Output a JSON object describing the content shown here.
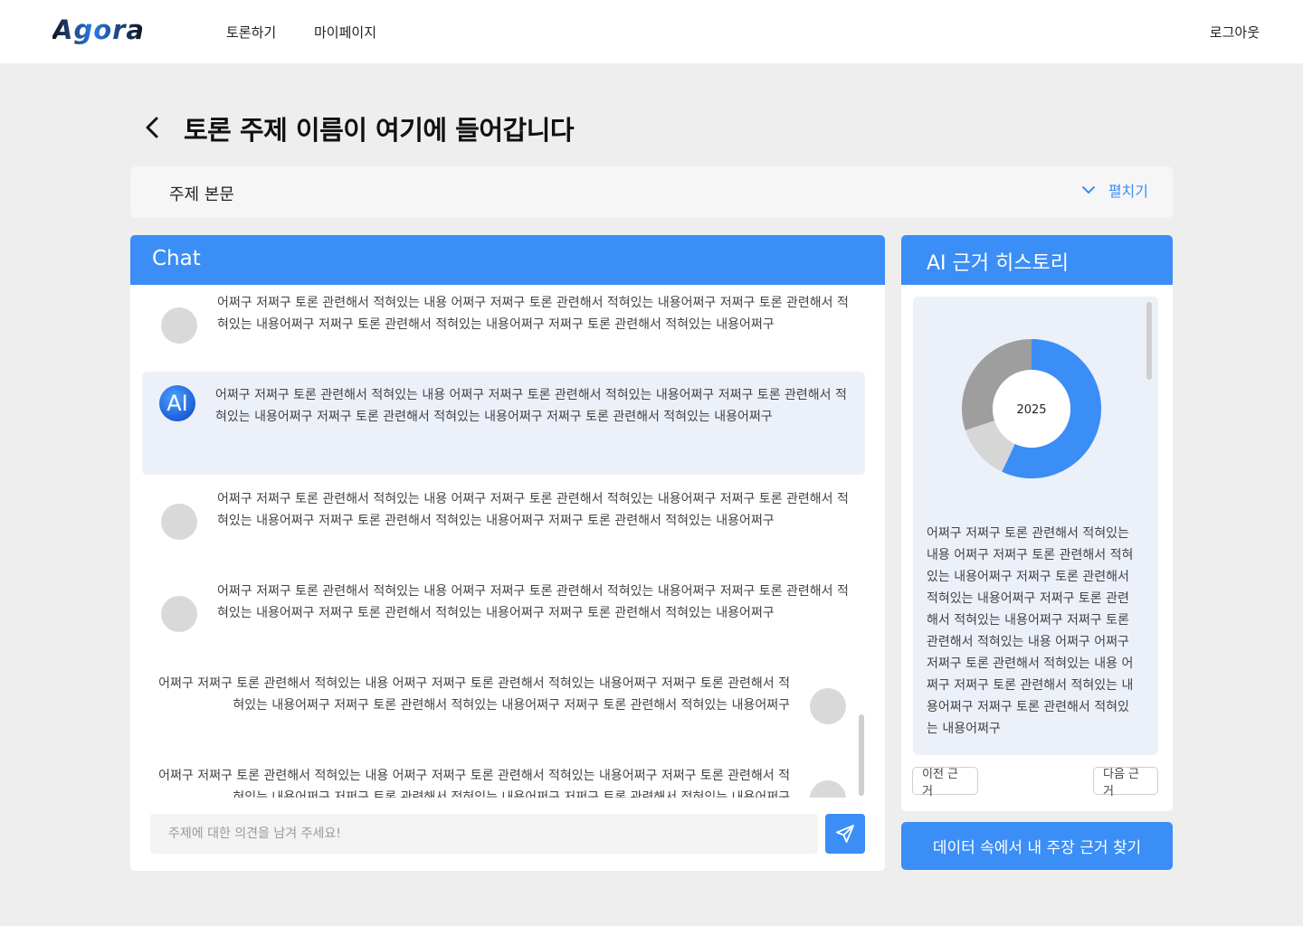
{
  "brand": {
    "logo_text": "Agora",
    "accent_color": "#3a8ef6"
  },
  "nav": {
    "items": [
      "토론하기",
      "마이페이지"
    ],
    "logout": "로그아웃"
  },
  "page": {
    "title": "토론 주제 이름이 여기에 들어갑니다",
    "back_icon": "chevron-left-icon"
  },
  "topic": {
    "label": "주제 본문",
    "expand_label": "펼치기",
    "expand_icon": "chevron-down-icon"
  },
  "chat": {
    "title": "Chat",
    "messages": [
      {
        "side": "left",
        "sender": "user",
        "text": "어쩌구 저쩌구 토론 관련해서 적혀있는 내용 어쩌구 저쩌구 토론 관련해서 적혀있는 내용어쩌구 저쩌구 토론 관련해서 적혀있는 내용어쩌구 저쩌구 토론 관련해서 적혀있는 내용어쩌구 저쩌구 토론 관련해서 적혀있는 내용어쩌구"
      },
      {
        "side": "left",
        "sender": "ai",
        "avatar_label": "AI",
        "text": "어쩌구 저쩌구 토론 관련해서 적혀있는 내용 어쩌구 저쩌구 토론 관련해서 적혀있는 내용어쩌구 저쩌구 토론 관련해서 적혀있는 내용어쩌구 저쩌구 토론 관련해서 적혀있는 내용어쩌구 저쩌구 토론 관련해서 적혀있는 내용어쩌구"
      },
      {
        "side": "left",
        "sender": "user",
        "text": "어쩌구 저쩌구 토론 관련해서 적혀있는 내용 어쩌구 저쩌구 토론 관련해서 적혀있는 내용어쩌구 저쩌구 토론 관련해서 적혀있는 내용어쩌구 저쩌구 토론 관련해서 적혀있는 내용어쩌구 저쩌구 토론 관련해서 적혀있는 내용어쩌구"
      },
      {
        "side": "left",
        "sender": "user",
        "text": "어쩌구 저쩌구 토론 관련해서 적혀있는 내용 어쩌구 저쩌구 토론 관련해서 적혀있는 내용어쩌구 저쩌구 토론 관련해서 적혀있는 내용어쩌구 저쩌구 토론 관련해서 적혀있는 내용어쩌구 저쩌구 토론 관련해서 적혀있는 내용어쩌구"
      },
      {
        "side": "right",
        "sender": "me",
        "text": "어쩌구 저쩌구 토론 관련해서 적혀있는 내용 어쩌구 저쩌구 토론 관련해서 적혀있는 내용어쩌구 저쩌구 토론 관련해서 적혀있는 내용어쩌구 저쩌구 토론 관련해서 적혀있는 내용어쩌구 저쩌구 토론 관련해서 적혀있는 내용어쩌구"
      },
      {
        "side": "right",
        "sender": "me",
        "text": "어쩌구 저쩌구 토론 관련해서 적혀있는 내용 어쩌구 저쩌구 토론 관련해서 적혀있는 내용어쩌구 저쩌구 토론 관련해서 적혀있는 내용어쩌구 저쩌구 토론 관련해서 적혀있는 내용어쩌구 저쩌구 토론 관련해서 적혀있는 내용어쩌구"
      }
    ],
    "input_placeholder": "주제에 대한 의견을 남겨 주세요!",
    "input_value": "",
    "send_icon": "send-icon"
  },
  "history": {
    "title": "AI 근거 히스토리",
    "donut_center_label": "2025",
    "donut_segments": [
      {
        "value": 57,
        "color": "#3a8ef6"
      },
      {
        "value": 13,
        "color": "#d6d6d6"
      },
      {
        "value": 30,
        "color": "#9e9e9e"
      }
    ],
    "text": "어쩌구 저쩌구 토론 관련해서 적혀있는 내용 어쩌구 저쩌구 토론 관련해서 적혀있는 내용어쩌구 저쩌구 토론 관련해서 적혀있는 내용어쩌구 저쩌구 토론 관련해서 적혀있는 내용어쩌구 저쩌구 토론 관련해서 적혀있는 내용 어쩌구 어쩌구 저쩌구 토론 관련해서 적혀있는 내용 어쩌구 저쩌구 토론 관련해서 적혀있는 내용어쩌구 저쩌구 토론 관련해서 적혀있는 내용어쩌구",
    "prev_label": "이전 근거",
    "next_label": "다음 근거"
  },
  "find_button": "데이터 속에서 내 주장 근거 찾기"
}
